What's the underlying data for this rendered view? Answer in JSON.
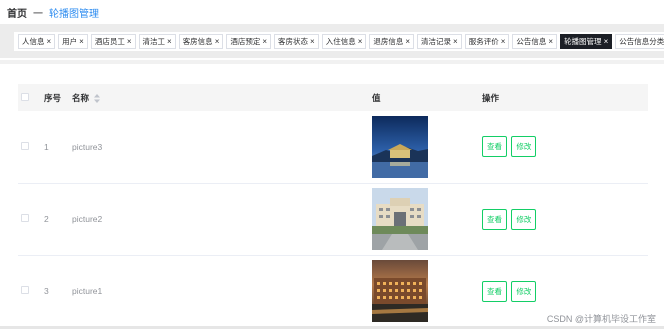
{
  "breadcrumb": {
    "home": "首页",
    "separator": "一",
    "current": "轮播图管理"
  },
  "tabs": [
    {
      "label": "人信息",
      "active": false
    },
    {
      "label": "用户",
      "active": false
    },
    {
      "label": "酒店员工",
      "active": false
    },
    {
      "label": "清洁工",
      "active": false
    },
    {
      "label": "客房信息",
      "active": false
    },
    {
      "label": "酒店预定",
      "active": false
    },
    {
      "label": "客房状态",
      "active": false
    },
    {
      "label": "入住信息",
      "active": false
    },
    {
      "label": "退房信息",
      "active": false
    },
    {
      "label": "清洁记录",
      "active": false
    },
    {
      "label": "服务评价",
      "active": false
    },
    {
      "label": "公告信息",
      "active": false
    },
    {
      "label": "轮播图管理",
      "active": true
    },
    {
      "label": "公告信息分类",
      "active": false
    }
  ],
  "table": {
    "headers": {
      "index": "序号",
      "name": "名称",
      "value": "值",
      "actions": "操作"
    },
    "rows": [
      {
        "index": "1",
        "name": "picture3",
        "view": "查看",
        "edit": "修改"
      },
      {
        "index": "2",
        "name": "picture2",
        "view": "查看",
        "edit": "修改"
      },
      {
        "index": "3",
        "name": "picture1",
        "view": "查看",
        "edit": "修改"
      }
    ]
  },
  "icons": {
    "sort": "sort-caret-icon",
    "close": "close-icon"
  },
  "colors": {
    "accent": "#2d8cf0",
    "button": "#13ce66",
    "active_tab": "#1c1f26"
  },
  "watermark": "CSDN @计算机毕设工作室"
}
